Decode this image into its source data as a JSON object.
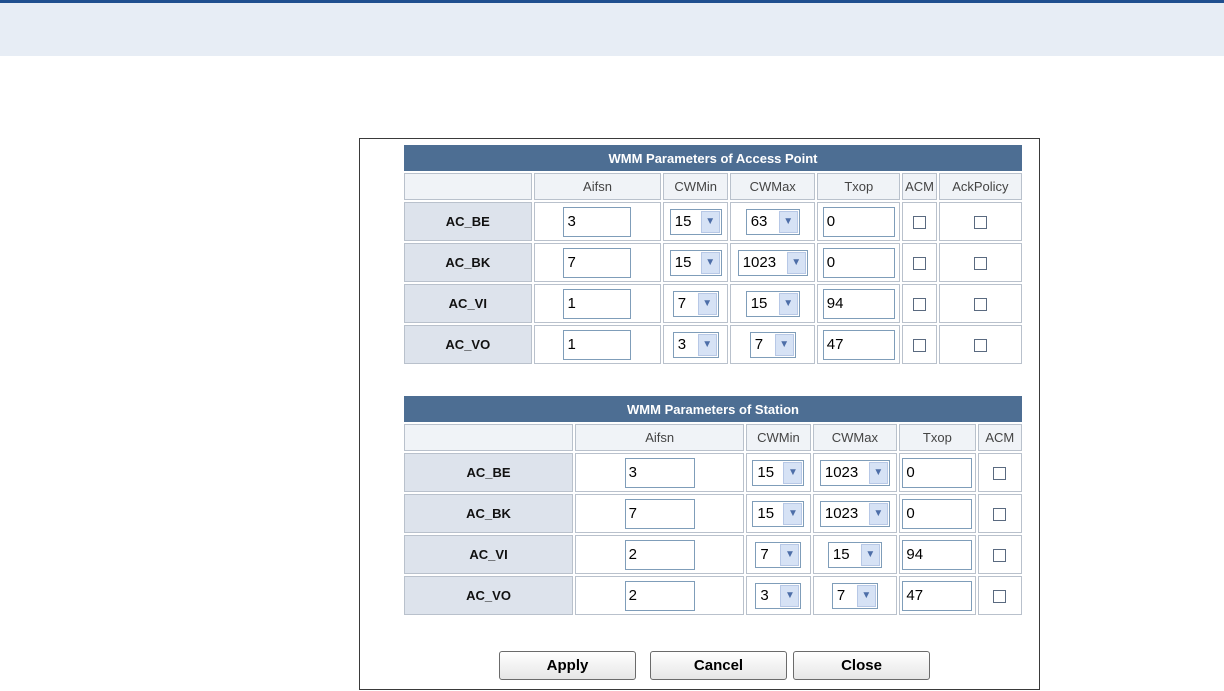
{
  "ap": {
    "title": "WMM Parameters of Access Point",
    "headers": [
      "Aifsn",
      "CWMin",
      "CWMax",
      "Txop",
      "ACM",
      "AckPolicy"
    ],
    "rows": [
      {
        "label": "AC_BE",
        "aifsn": "3",
        "cwmin": "15",
        "cwmax": "63",
        "txop": "0",
        "acm": false,
        "ackpolicy": false
      },
      {
        "label": "AC_BK",
        "aifsn": "7",
        "cwmin": "15",
        "cwmax": "1023",
        "txop": "0",
        "acm": false,
        "ackpolicy": false
      },
      {
        "label": "AC_VI",
        "aifsn": "1",
        "cwmin": "7",
        "cwmax": "15",
        "txop": "94",
        "acm": false,
        "ackpolicy": false
      },
      {
        "label": "AC_VO",
        "aifsn": "1",
        "cwmin": "3",
        "cwmax": "7",
        "txop": "47",
        "acm": false,
        "ackpolicy": false
      }
    ]
  },
  "station": {
    "title": "WMM Parameters of Station",
    "headers": [
      "Aifsn",
      "CWMin",
      "CWMax",
      "Txop",
      "ACM"
    ],
    "rows": [
      {
        "label": "AC_BE",
        "aifsn": "3",
        "cwmin": "15",
        "cwmax": "1023",
        "txop": "0",
        "acm": false
      },
      {
        "label": "AC_BK",
        "aifsn": "7",
        "cwmin": "15",
        "cwmax": "1023",
        "txop": "0",
        "acm": false
      },
      {
        "label": "AC_VI",
        "aifsn": "2",
        "cwmin": "7",
        "cwmax": "15",
        "txop": "94",
        "acm": false
      },
      {
        "label": "AC_VO",
        "aifsn": "2",
        "cwmin": "3",
        "cwmax": "7",
        "txop": "47",
        "acm": false
      }
    ]
  },
  "buttons": {
    "apply": "Apply",
    "cancel": "Cancel",
    "close": "Close"
  },
  "icons": {
    "dropdown": "chevron-down-icon",
    "checkbox": "checkbox-unchecked"
  },
  "colors": {
    "title_bar": "#4d6e93",
    "row_label_bg": "#dde3ec",
    "top_line": "#1f4f8f",
    "top_band": "#e7edf5"
  }
}
